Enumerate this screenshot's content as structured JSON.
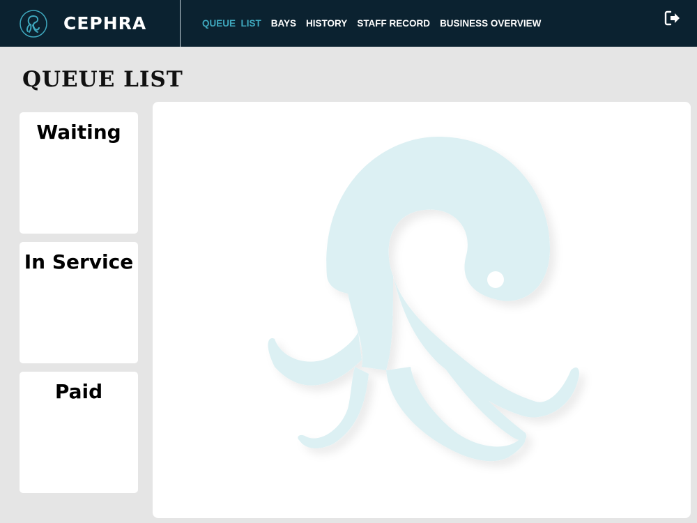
{
  "header": {
    "brand": "CEPHRA",
    "nav": [
      {
        "label": "QUEUE  LIST",
        "active": true
      },
      {
        "label": "BAYS",
        "active": false
      },
      {
        "label": "HISTORY",
        "active": false
      },
      {
        "label": "STAFF RECORD",
        "active": false
      },
      {
        "label": "BUSINESS OVERVIEW",
        "active": false
      }
    ],
    "logout_icon": "sign-out-icon"
  },
  "page": {
    "title": "QUEUE LIST"
  },
  "status_cards": [
    {
      "title": "Waiting"
    },
    {
      "title": "In Service"
    },
    {
      "title": "Paid"
    }
  ],
  "colors": {
    "header_bg": "#0b2230",
    "accent": "#3fa9bf",
    "page_bg": "#e5e5e5",
    "watermark": "#dcf0f3"
  }
}
